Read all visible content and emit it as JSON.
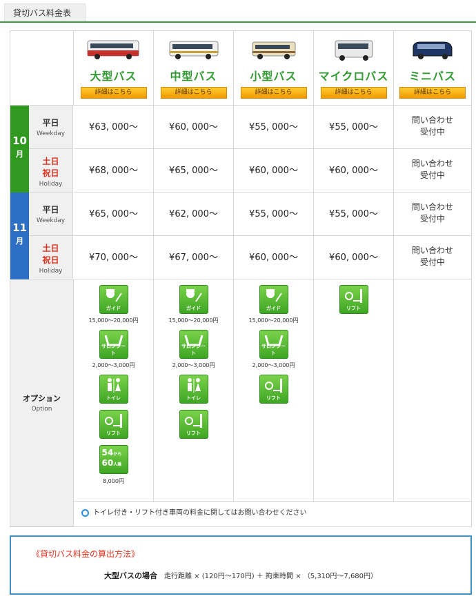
{
  "tab_title": "貸切バス料金表",
  "buses": [
    {
      "name": "大型バス",
      "detail": "詳細はこちら",
      "icon": "large-bus-icon",
      "color": "#c9302c"
    },
    {
      "name": "中型バス",
      "detail": "詳細はこちら",
      "icon": "medium-bus-icon",
      "color": "#f0f0f0"
    },
    {
      "name": "小型バス",
      "detail": "詳細はこちら",
      "icon": "small-bus-icon",
      "color": "#e8d9b0"
    },
    {
      "name": "マイクロバス",
      "detail": "詳細はこちら",
      "icon": "micro-bus-icon",
      "color": "#e6e6e6"
    },
    {
      "name": "ミニバス",
      "detail": "詳細はこちら",
      "icon": "mini-bus-icon",
      "color": "#1f3563"
    }
  ],
  "months": [
    {
      "num": "10",
      "unit": "月",
      "color": "#2f9a1f",
      "rows": [
        {
          "jp": "平日",
          "en": "Weekday",
          "holiday": false,
          "prices": [
            "¥63, 000〜",
            "¥60, 000〜",
            "¥55, 000〜",
            "¥55, 000〜"
          ],
          "mini": [
            "問い合わせ",
            "受付中"
          ]
        },
        {
          "jp1": "土日",
          "jp2": "祝日",
          "en": "Holiday",
          "holiday": true,
          "prices": [
            "¥68, 000〜",
            "¥65, 000〜",
            "¥60, 000〜",
            "¥60, 000〜"
          ],
          "mini": [
            "問い合わせ",
            "受付中"
          ]
        }
      ]
    },
    {
      "num": "11",
      "unit": "月",
      "color": "#2c6fc4",
      "rows": [
        {
          "jp": "平日",
          "en": "Weekday",
          "holiday": false,
          "prices": [
            "¥65, 000〜",
            "¥62, 000〜",
            "¥55, 000〜",
            "¥55, 000〜"
          ],
          "mini": [
            "問い合わせ",
            "受付中"
          ]
        },
        {
          "jp1": "土日",
          "jp2": "祝日",
          "en": "Holiday",
          "holiday": true,
          "prices": [
            "¥70, 000〜",
            "¥67, 000〜",
            "¥60, 000〜",
            "¥60, 000〜"
          ],
          "mini": [
            "問い合わせ",
            "受付中"
          ]
        }
      ]
    }
  ],
  "option_label": {
    "jp": "オプション",
    "en": "Option"
  },
  "options": {
    "guide": {
      "caption": "ガイド",
      "price": "15,000〜20,000円",
      "icon": "guide-icon"
    },
    "salon": {
      "caption": "サロンシート",
      "price": "2,000〜3,000円",
      "icon": "salon-seat-icon"
    },
    "toilet": {
      "caption": "トイレ",
      "icon": "toilet-icon"
    },
    "lift": {
      "caption": "リフト",
      "icon": "lift-icon"
    },
    "seats": {
      "line1": "54",
      "small1": "から",
      "line2": "60",
      "small2": "人乗",
      "price": "8,000円",
      "icon": "seats-54-60-icon"
    }
  },
  "note": "トイレ付き・リフト付き車両の料金に関してはお問い合わせください",
  "calc": {
    "title": "《貸切バス料金の算出方法》",
    "label": "大型バスの場合",
    "formula": "走行距離 × (120円〜170円) ＋ 拘束時間 × （5,310円〜7,680円）"
  }
}
